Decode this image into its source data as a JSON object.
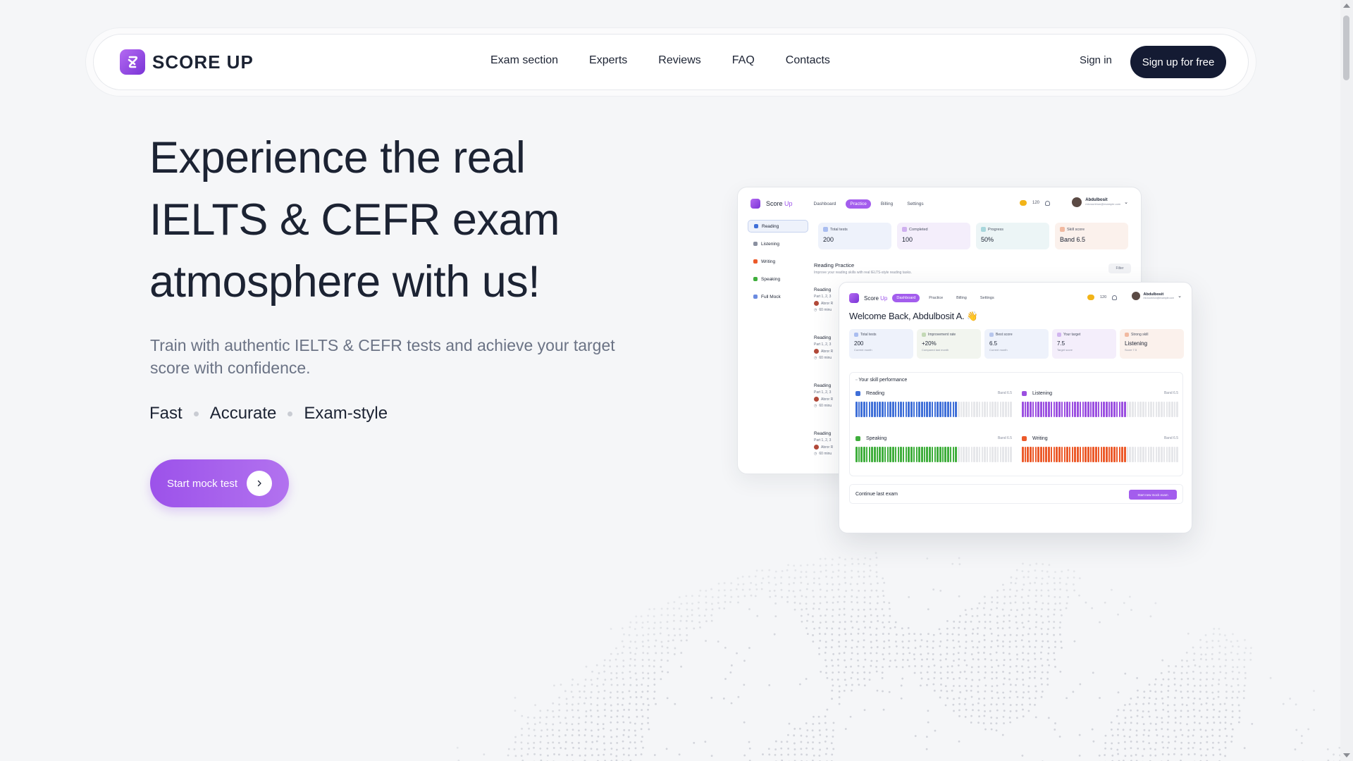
{
  "brand": {
    "name": "SCORE UP",
    "primary": "#9c52ea",
    "dark": "#141b33"
  },
  "nav": {
    "links": [
      "Exam section",
      "Experts",
      "Reviews",
      "FAQ",
      "Contacts"
    ],
    "sign_in": "Sign in",
    "signup": "Sign up for free"
  },
  "hero": {
    "title_lines": [
      "Experience the real",
      "IELTS & CEFR exam",
      "atmosphere with us!"
    ],
    "subtitle": "Train with authentic IELTS & CEFR tests and achieve your target score with confidence.",
    "features": [
      "Fast",
      "Accurate",
      "Exam-style"
    ],
    "cta": "Start mock test"
  },
  "back_card": {
    "brand_a": "Score",
    "brand_b": "Up",
    "tabs": [
      "Dashboard",
      "Practice",
      "Billing",
      "Settings"
    ],
    "active_tab": 1,
    "coins": "120",
    "user_name": "Abdulbosit",
    "user_email": "mirzourkhon@example.com",
    "sidebar": [
      "Reading",
      "Listening",
      "Writing",
      "Speaking",
      "Full Mock"
    ],
    "stats": [
      {
        "label": "Total tests",
        "value": "200"
      },
      {
        "label": "Completed",
        "value": "100"
      },
      {
        "label": "Progress",
        "value": "50%"
      },
      {
        "label": "Skill score",
        "value": "Band 6.5"
      }
    ],
    "section_title": "Reading Practice",
    "section_sub": "Improve your reading skills with real IELTS-style reading tasks.",
    "filter": "Filter",
    "list_item_title": "Reading",
    "list_item_parts": "Part 1, 2, 3",
    "list_item_author": "Abror R",
    "list_item_time": "60 minu"
  },
  "front_card": {
    "brand_a": "Score",
    "brand_b": "Up",
    "tabs": [
      "Dashboard",
      "Practice",
      "Billing",
      "Settings"
    ],
    "active_tab": 0,
    "coins": "120",
    "user_name": "Abdulbosit",
    "user_email": "mirzourkhon@example.com",
    "welcome": "Welcome Back, Abdulbosit A. 👋",
    "stats": [
      {
        "label": "Total tests",
        "value": "200",
        "sub": "Current month"
      },
      {
        "label": "Improvement rate",
        "value": "+20%",
        "sub": "Compared last month"
      },
      {
        "label": "Best score",
        "value": "6.5",
        "sub": "Current month"
      },
      {
        "label": "Your target",
        "value": "7.5",
        "sub": "Target score"
      },
      {
        "label": "Strong skill",
        "value": "Listening",
        "sub": "Score 7.5"
      }
    ],
    "perf_title": "Your skill performance",
    "skills": [
      {
        "name": "Reading",
        "band": "Band 6.5",
        "color": "#3f6fd8",
        "level": 0.65
      },
      {
        "name": "Listening",
        "band": "Band 6.5",
        "color": "#9b4fe0",
        "level": 0.67
      },
      {
        "name": "Speaking",
        "band": "Band 6.5",
        "color": "#3fae3c",
        "level": 0.65
      },
      {
        "name": "Writing",
        "band": "Band 6.5",
        "color": "#ec5a2a",
        "level": 0.67
      }
    ],
    "continue_label": "Continue last exam",
    "continue_btn": "Start new mock exam"
  }
}
